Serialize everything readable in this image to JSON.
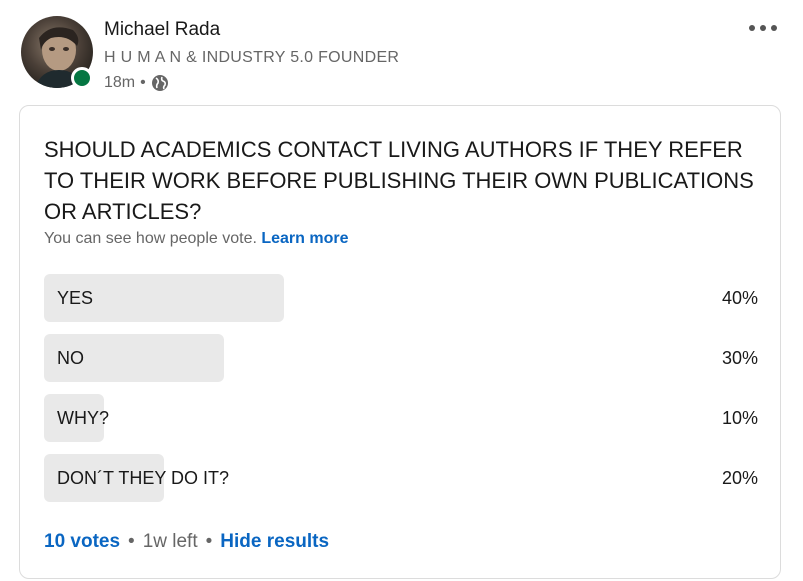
{
  "author": {
    "name": "Michael Rada",
    "headline": "H U M A N & INDUSTRY 5.0 FOUNDER",
    "time_ago": "18m",
    "separator": "•",
    "visibility_icon": "globe-icon",
    "presence_color": "#057642"
  },
  "menu": {
    "icon": "more-horizontal-icon"
  },
  "poll": {
    "question": "SHOULD ACADEMICS CONTACT LIVING AUTHORS IF THEY REFER TO THEIR WORK BEFORE PUBLISHING THEIR OWN PUBLICATIONS OR ARTICLES?",
    "visibility_note": "You can see how people vote.",
    "learn_more": "Learn more",
    "options": [
      {
        "label": "YES",
        "percent_text": "40%",
        "percent": 40
      },
      {
        "label": "NO",
        "percent_text": "30%",
        "percent": 30
      },
      {
        "label": "WHY?",
        "percent_text": "10%",
        "percent": 10
      },
      {
        "label": "DON´T THEY DO IT?",
        "percent_text": "20%",
        "percent": 20
      }
    ],
    "votes": "10 votes",
    "time_left": "1w left",
    "hide_results": "Hide results",
    "separator": "•"
  },
  "colors": {
    "link": "#0a66c2",
    "bar": "#e9e9e9",
    "muted_text": "#666666"
  }
}
